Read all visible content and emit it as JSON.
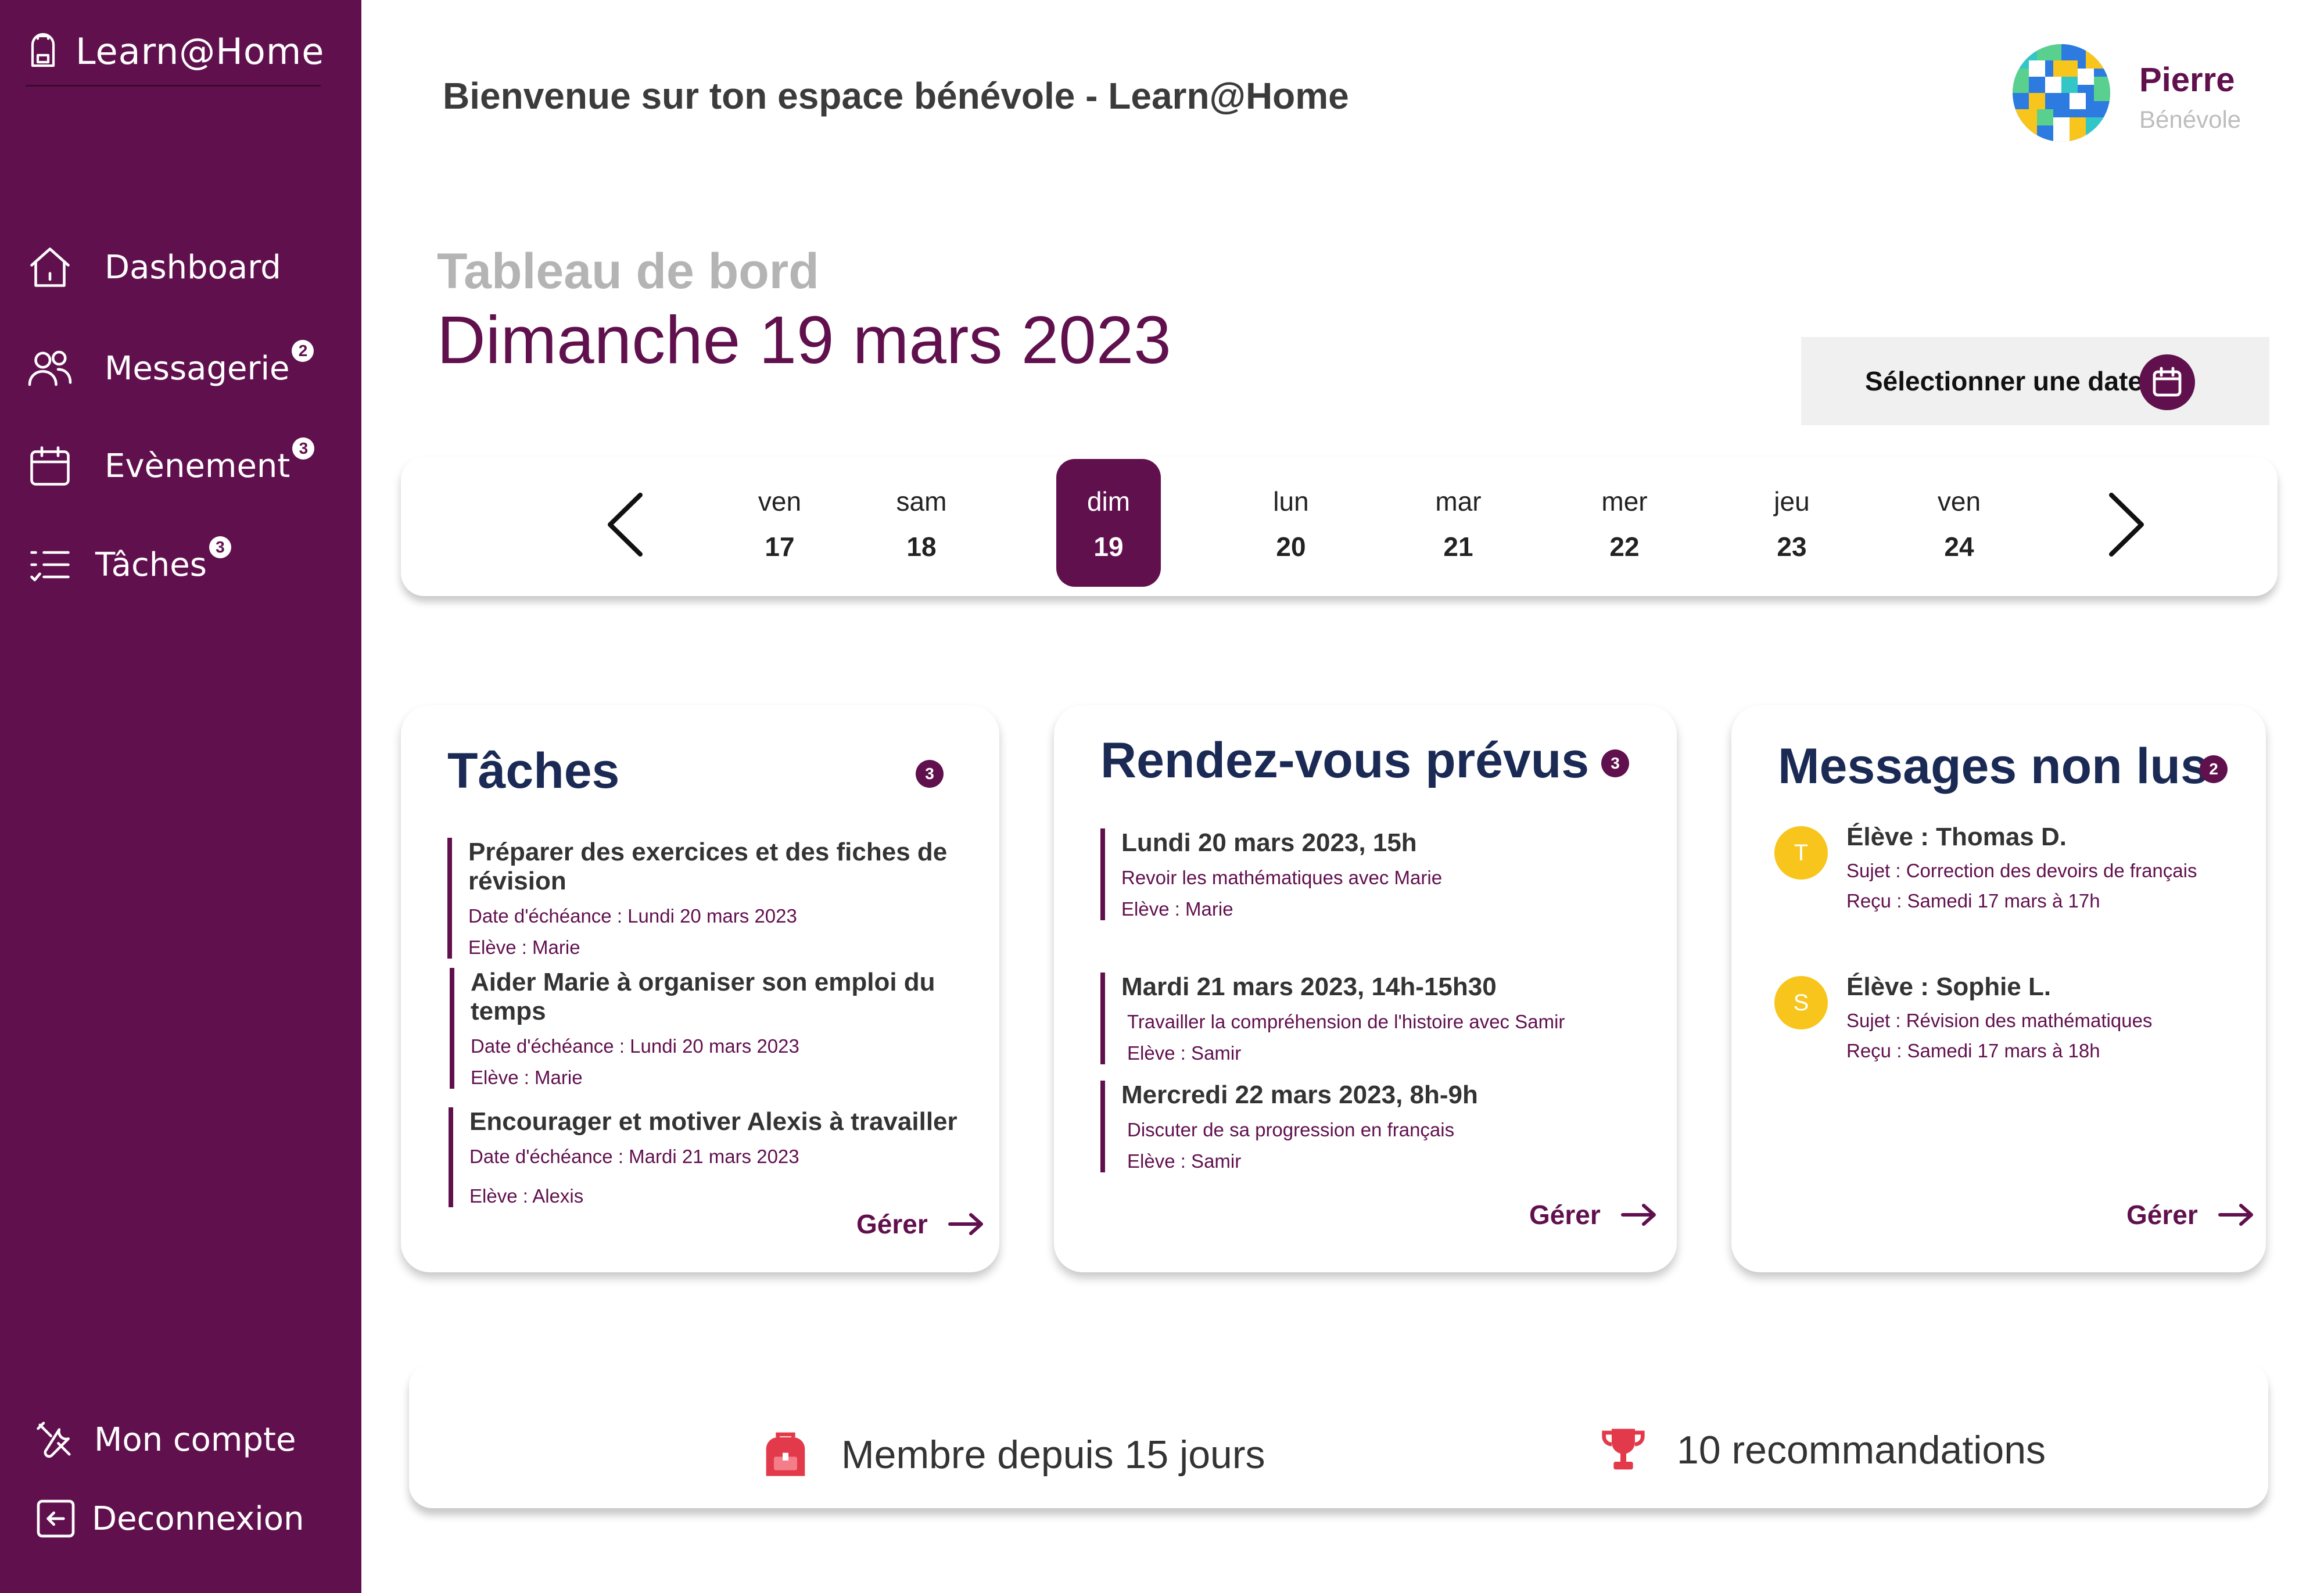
{
  "app": {
    "name": "Learn@Home",
    "brand_color": "#61104e",
    "accent_color": "#f7c51c"
  },
  "sidebar": {
    "items": [
      {
        "label": "Dashboard",
        "icon": "home-icon",
        "badge": ""
      },
      {
        "label": "Messagerie",
        "icon": "users-icon",
        "badge": "2"
      },
      {
        "label": "Evènement",
        "icon": "calendar-icon",
        "badge": "3"
      },
      {
        "label": "Tâches",
        "icon": "list-check-icon",
        "badge": "3"
      }
    ],
    "bottom": [
      {
        "label": "Mon compte",
        "icon": "tools-icon"
      },
      {
        "label": "Deconnexion",
        "icon": "logout-icon"
      }
    ]
  },
  "header": {
    "welcome": "Bienvenue sur ton espace bénévole - Learn@Home",
    "user_name": "Pierre",
    "user_role": "Bénévole"
  },
  "main": {
    "subtitle": "Tableau de bord",
    "date": "Dimanche 19 mars 2023",
    "date_picker_label": "Sélectionner une date"
  },
  "week": {
    "days": [
      {
        "name": "ven",
        "num": "17",
        "active": false
      },
      {
        "name": "sam",
        "num": "18",
        "active": false
      },
      {
        "name": "dim",
        "num": "19",
        "active": true
      },
      {
        "name": "lun",
        "num": "20",
        "active": false
      },
      {
        "name": "mar",
        "num": "21",
        "active": false
      },
      {
        "name": "mer",
        "num": "22",
        "active": false
      },
      {
        "name": "jeu",
        "num": "23",
        "active": false
      },
      {
        "name": "ven",
        "num": "24",
        "active": false
      }
    ]
  },
  "tasks": {
    "title": "Tâches",
    "count": "3",
    "manage": "Gérer",
    "items": [
      {
        "title": "Préparer des exercices et des fiches de révision",
        "due": "Date d'échéance : Lundi 20 mars 2023",
        "student": "Elève : Marie"
      },
      {
        "title": "Aider Marie à organiser son emploi du temps",
        "due": "Date d'échéance : Lundi 20 mars 2023",
        "student": "Elève : Marie"
      },
      {
        "title": "Encourager et motiver Alexis à travailler",
        "due": "Date d'échéance : Mardi 21 mars 2023",
        "student": "Elève : Alexis"
      }
    ]
  },
  "appointments": {
    "title": "Rendez-vous prévus",
    "count": "3",
    "manage": "Gérer",
    "items": [
      {
        "title": "Lundi 20 mars 2023, 15h",
        "desc": "Revoir les mathématiques avec Marie",
        "student": "Elève : Marie"
      },
      {
        "title": "Mardi 21 mars 2023, 14h-15h30",
        "desc": "Travailler la compréhension de l'histoire avec Samir",
        "student": "Elève : Samir"
      },
      {
        "title": "Mercredi 22 mars 2023, 8h-9h",
        "desc": "Discuter de sa progression en français",
        "student": "Elève : Samir"
      }
    ]
  },
  "messages": {
    "title": "Messages non lus",
    "count": "2",
    "manage": "Gérer",
    "items": [
      {
        "initial": "T",
        "from": "Élève : Thomas D.",
        "subject": "Sujet : Correction des devoirs de français",
        "received": "Reçu : Samedi 17 mars à 17h"
      },
      {
        "initial": "S",
        "from": "Élève : Sophie L.",
        "subject": "Sujet : Révision des mathématiques",
        "received": "Reçu : Samedi 17 mars à 18h"
      }
    ]
  },
  "stats": {
    "member": "Membre depuis 15 jours",
    "recommendations": "10 recommandations"
  }
}
